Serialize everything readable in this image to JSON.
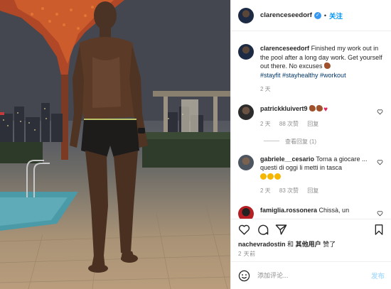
{
  "post": {
    "author": "clarenceseedorf",
    "verified": true,
    "follow_label": "关注",
    "separator": "•",
    "caption": {
      "text": "Finished my work out in the pool after a long day work. Get yourself out there. No excuses",
      "emoji": "flexed-biceps",
      "hashtags": "#stayfit #stayhealthy #workout",
      "time": "2 天"
    }
  },
  "comments": [
    {
      "user": "patrickkluivert9",
      "emojis": [
        "brown-biceps",
        "brown-biceps",
        "red-heart"
      ],
      "time": "2 天",
      "likes": "88 次赞",
      "reply_label": "回复",
      "view_replies": "查看回复 (1)"
    },
    {
      "user": "gabriele__cesario",
      "text": "Torna a giocare ... questi di oggi li metti in tasca",
      "emojis": [
        "laughing",
        "laughing",
        "laughing"
      ],
      "time": "2 天",
      "likes": "83 次赞",
      "reply_label": "回复"
    },
    {
      "user": "famiglia.rossonera",
      "text": "Chissà, un"
    }
  ],
  "actions": {
    "like_icon": "heart-outline-icon",
    "comment_icon": "comment-bubble-icon",
    "share_icon": "paper-plane-icon",
    "save_icon": "bookmark-icon"
  },
  "likes_line": {
    "user": "nachevradostin",
    "connector": "和",
    "others": "其他用户",
    "suffix": "赞了"
  },
  "timestamp": "2 天前",
  "composer": {
    "placeholder": "添加评论...",
    "post_label": "发布",
    "emoji_icon": "smiley-icon"
  },
  "colors": {
    "link_blue": "#0095f6",
    "verified_blue": "#3897f0",
    "hashtag_navy": "#00376b",
    "muted_gray": "#8e8e8e",
    "post_disabled": "#b2dffc"
  }
}
